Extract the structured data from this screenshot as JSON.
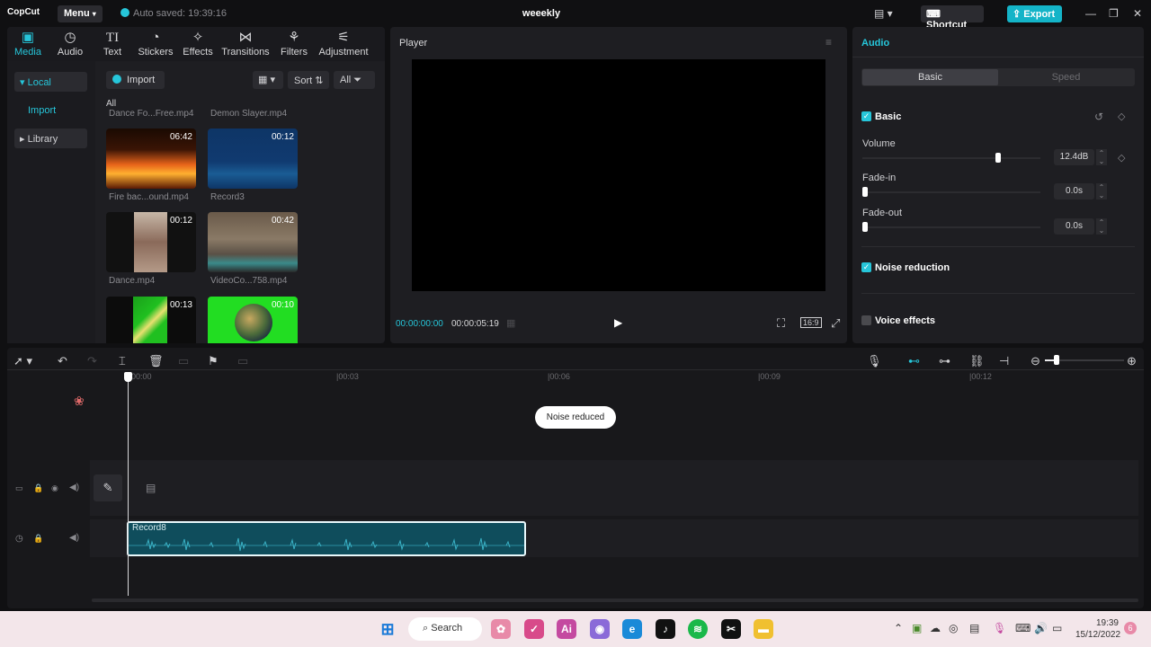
{
  "app": {
    "logo": "CopCut",
    "menu_label": "Menu",
    "auto_saved": "Auto saved: 19:39:16",
    "project_title": "weeekly",
    "shortcut_label": "Shortcut",
    "export_label": "Export"
  },
  "toolbar": {
    "tools": [
      {
        "label": "Media",
        "icon": "media-icon"
      },
      {
        "label": "Audio",
        "icon": "audio-icon"
      },
      {
        "label": "Text",
        "icon": "text-icon"
      },
      {
        "label": "Stickers",
        "icon": "stickers-icon"
      },
      {
        "label": "Effects",
        "icon": "effects-icon"
      },
      {
        "label": "Transitions",
        "icon": "transitions-icon"
      },
      {
        "label": "Filters",
        "icon": "filters-icon"
      },
      {
        "label": "Adjustment",
        "icon": "adjustment-icon"
      }
    ],
    "active": "Media"
  },
  "media_panel": {
    "nav": {
      "local": "Local",
      "import": "Import",
      "library": "Library"
    },
    "import_button": "Import",
    "sort_label": "Sort",
    "filter_label": "All",
    "section_label": "All",
    "items": [
      {
        "name": "Dance Fo...Free.mp4",
        "duration": ""
      },
      {
        "name": "Demon Slayer.mp4",
        "duration": ""
      },
      {
        "name": "Fire bac...ound.mp4",
        "duration": "06:42"
      },
      {
        "name": "Record3",
        "duration": "00:12"
      },
      {
        "name": "Dance.mp4",
        "duration": "00:12"
      },
      {
        "name": "VideoCo...758.mp4",
        "duration": "00:42"
      },
      {
        "name": "",
        "duration": "00:13"
      },
      {
        "name": "",
        "duration": "00:10"
      }
    ]
  },
  "player": {
    "title": "Player",
    "current_time": "00:00:00:00",
    "total_time": "00:00:05:19",
    "ratio": "16:9"
  },
  "audio_panel": {
    "title": "Audio",
    "tabs": [
      "Basic",
      "Speed"
    ],
    "active_tab": "Basic",
    "basic_label": "Basic",
    "volume_label": "Volume",
    "volume_value": "12.4dB",
    "volume_level": 0.55,
    "fadein_label": "Fade-in",
    "fadein_value": "0.0s",
    "fadeout_label": "Fade-out",
    "fadeout_value": "0.0s",
    "noise_label": "Noise reduction",
    "noise_checked": true,
    "voice_label": "Voice effects",
    "voice_checked": false
  },
  "timeline": {
    "ruler": [
      "00:00",
      "|00:03",
      "|00:06",
      "|00:09",
      "|00:12"
    ],
    "toast": "Noise reduced",
    "audio_clip": "Record8"
  },
  "taskbar": {
    "search": "Search",
    "time": "19:39",
    "date": "15/12/2022",
    "notif": "6"
  },
  "colors": {
    "accent": "#14b4c8",
    "panel": "#1e1e22",
    "background": "#101012"
  }
}
